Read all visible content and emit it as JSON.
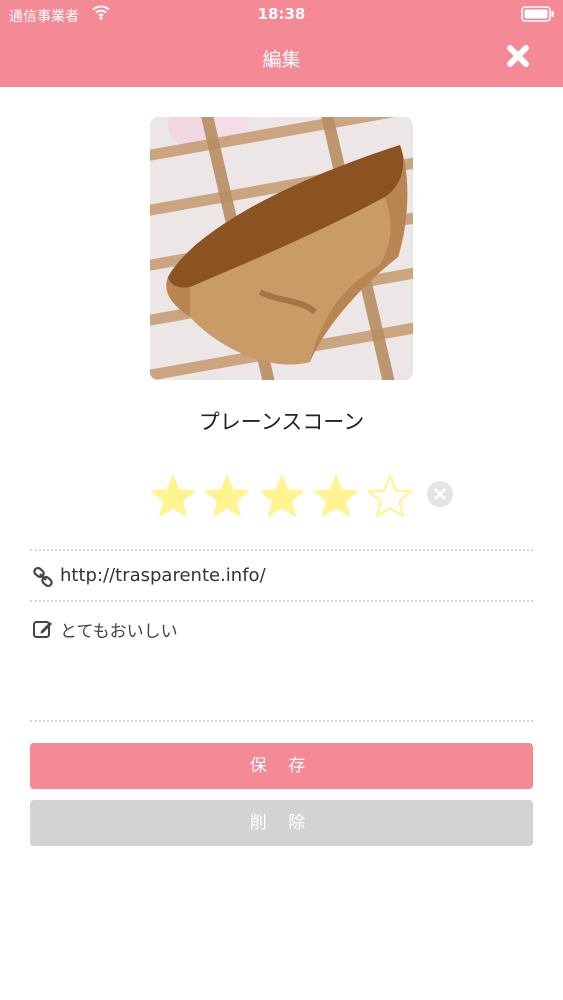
{
  "status_bar": {
    "carrier": "通信事業者",
    "time": "18:38"
  },
  "nav": {
    "title": "編集"
  },
  "item": {
    "name": "プレーンスコーン",
    "rating": 4,
    "rating_max": 5
  },
  "fields": {
    "url": "http://trasparente.info/",
    "memo": "とてもおいしい"
  },
  "buttons": {
    "save_label": "保 存",
    "delete_label": "削 除"
  },
  "colors": {
    "accent": "#f48a96",
    "star_filled": "#fff48f",
    "star_empty_outline": "#fff48f",
    "delete_button": "#d3d3d6"
  }
}
